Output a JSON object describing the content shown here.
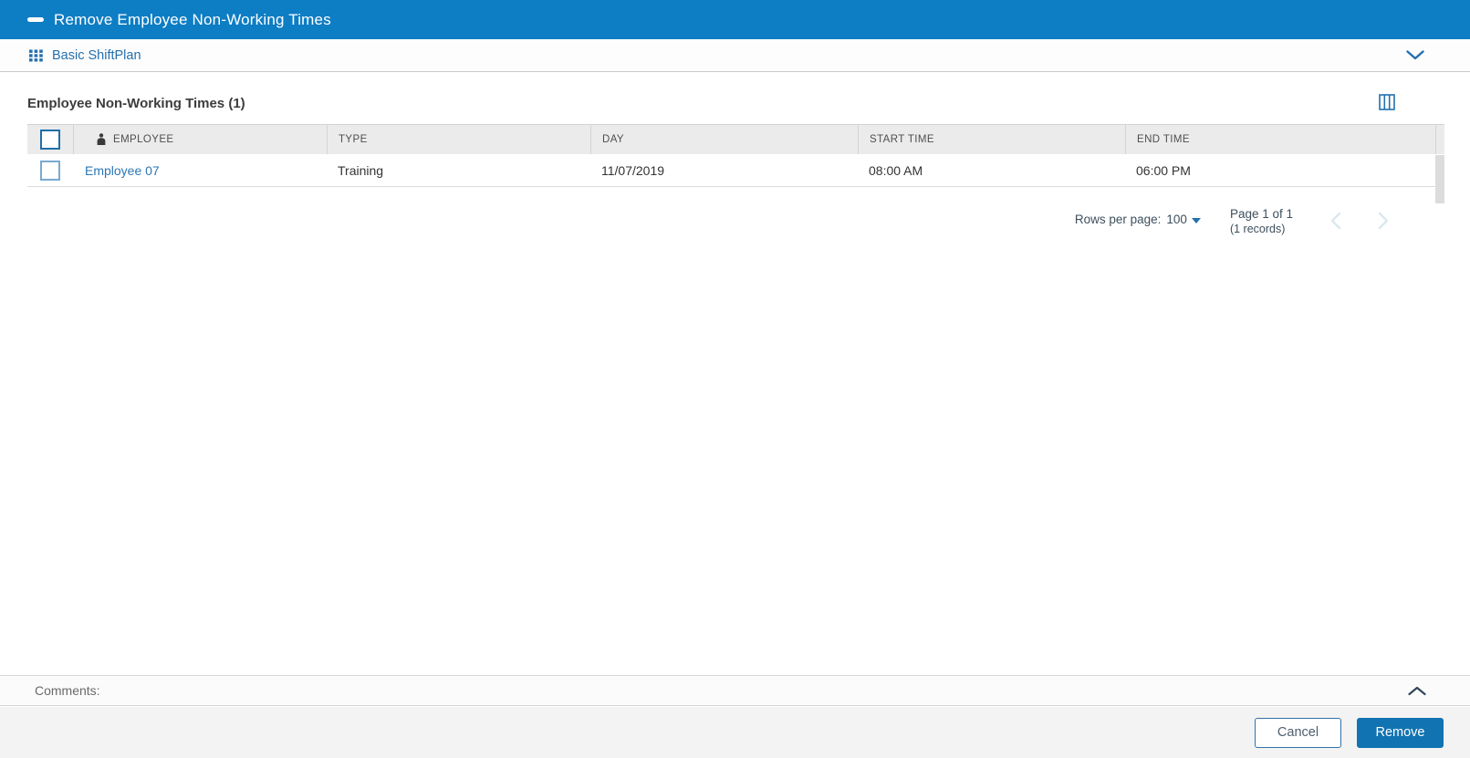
{
  "title_bar": {
    "title": "Remove Employee Non-Working Times"
  },
  "context_bar": {
    "label": "Basic ShiftPlan"
  },
  "section": {
    "title": "Employee Non-Working Times (1)"
  },
  "table": {
    "columns": [
      "EMPLOYEE",
      "TYPE",
      "DAY",
      "START TIME",
      "END TIME"
    ],
    "rows": [
      {
        "employee": "Employee 07",
        "type": "Training",
        "day": "11/07/2019",
        "start_time": "08:00 AM",
        "end_time": "06:00 PM"
      }
    ]
  },
  "pagination": {
    "rows_per_page_label": "Rows per page:",
    "rows_per_page_value": "100",
    "page_info": "Page 1 of 1",
    "records_info": "(1 records)"
  },
  "comments": {
    "label": "Comments:"
  },
  "footer": {
    "cancel_label": "Cancel",
    "remove_label": "Remove"
  },
  "icons": {
    "title_minus": "minus",
    "context_grid": "grid",
    "context_expand": "chevron-down",
    "columns_picker": "columns",
    "employee_header": "person",
    "rows_per_page": "caret-down",
    "prev_page": "chevron-left",
    "next_page": "chevron-right",
    "comments_collapse": "chevron-up"
  },
  "colors": {
    "title_bar_blue": "#0d7dc4",
    "accent_blue": "#2470ae",
    "link_blue": "#2d77b5",
    "remove_button_blue": "#1173b2",
    "header_row_gray": "#ebebeb",
    "footer_gray": "#f3f3f3"
  }
}
